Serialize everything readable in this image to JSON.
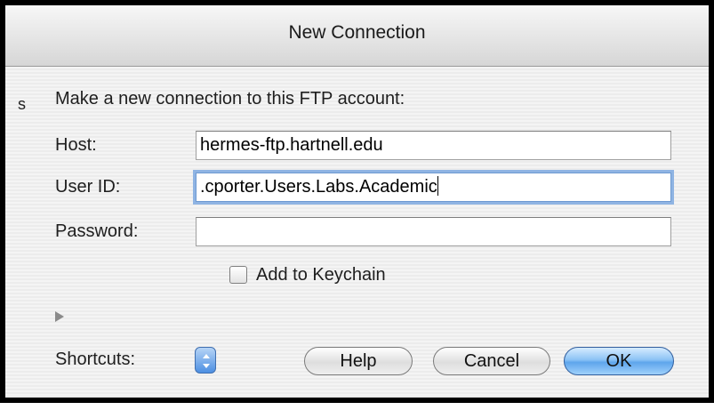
{
  "window": {
    "title": "New Connection",
    "background_glyph": "s"
  },
  "form": {
    "heading": "Make a new connection to this FTP account:",
    "host": {
      "label": "Host:",
      "value": "hermes-ftp.hartnell.edu"
    },
    "user_id": {
      "label": "User ID:",
      "value": ".cporter.Users.Labs.Academic"
    },
    "password": {
      "label": "Password:",
      "value": ""
    },
    "keychain": {
      "label": "Add to Keychain",
      "checked": false
    }
  },
  "footer": {
    "shortcuts_label": "Shortcuts:",
    "help_label": "Help",
    "cancel_label": "Cancel",
    "ok_label": "OK"
  },
  "colors": {
    "default_button": "#5ea5ec",
    "focus_ring": "#8fb4e3"
  }
}
